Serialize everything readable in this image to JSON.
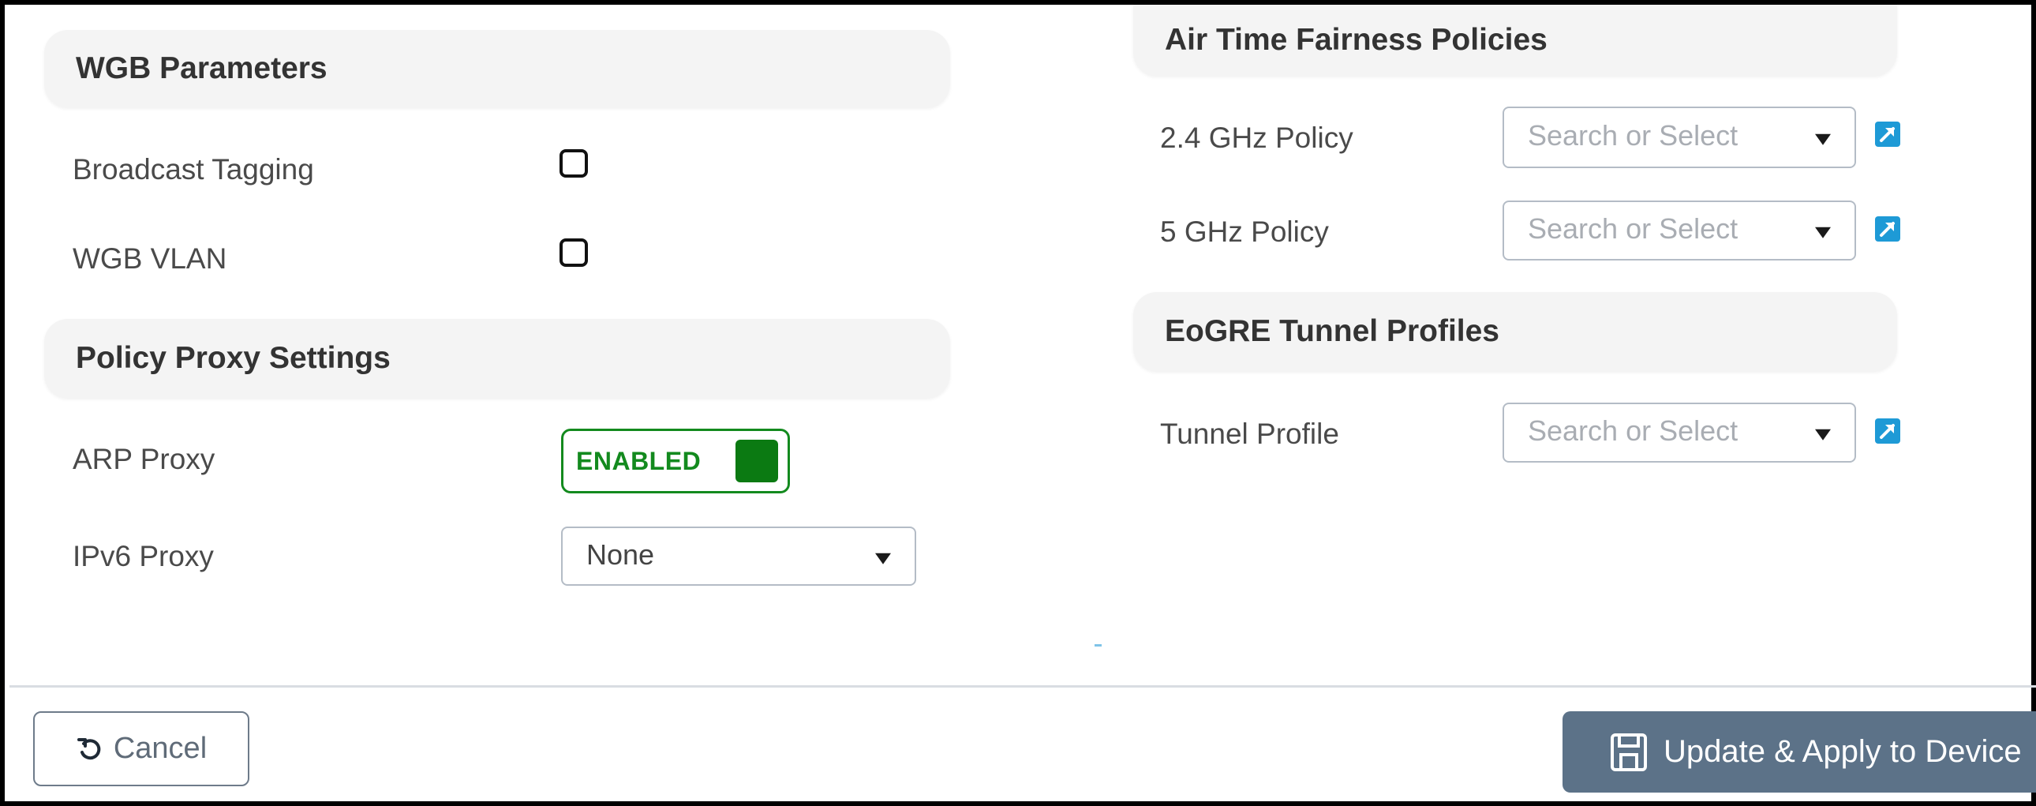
{
  "left": {
    "wgb_section": {
      "title": "WGB Parameters",
      "broadcast_tagging": {
        "label": "Broadcast Tagging",
        "checked": false
      },
      "wgb_vlan": {
        "label": "WGB VLAN",
        "checked": false
      }
    },
    "proxy_section": {
      "title": "Policy Proxy Settings",
      "arp_proxy": {
        "label": "ARP Proxy",
        "toggle_text": "ENABLED",
        "enabled": true,
        "color": "#138a1e"
      },
      "ipv6_proxy": {
        "label": "IPv6 Proxy",
        "value": "None"
      }
    }
  },
  "right": {
    "atf_section": {
      "title": "Air Time Fairness Policies",
      "policy_24": {
        "label": "2.4 GHz Policy",
        "placeholder": "Search or Select",
        "icon": "external-link-icon"
      },
      "policy_5": {
        "label": "5 GHz Policy",
        "placeholder": "Search or Select",
        "icon": "external-link-icon"
      }
    },
    "eogre_section": {
      "title": "EoGRE Tunnel Profiles",
      "tunnel_profile": {
        "label": "Tunnel Profile",
        "placeholder": "Search or Select",
        "icon": "external-link-icon"
      }
    }
  },
  "footer": {
    "cancel_label": "Cancel",
    "cancel_icon": "undo-icon",
    "apply_label": "Update & Apply to Device",
    "apply_icon": "save-icon",
    "apply_color": "#5c7288"
  }
}
